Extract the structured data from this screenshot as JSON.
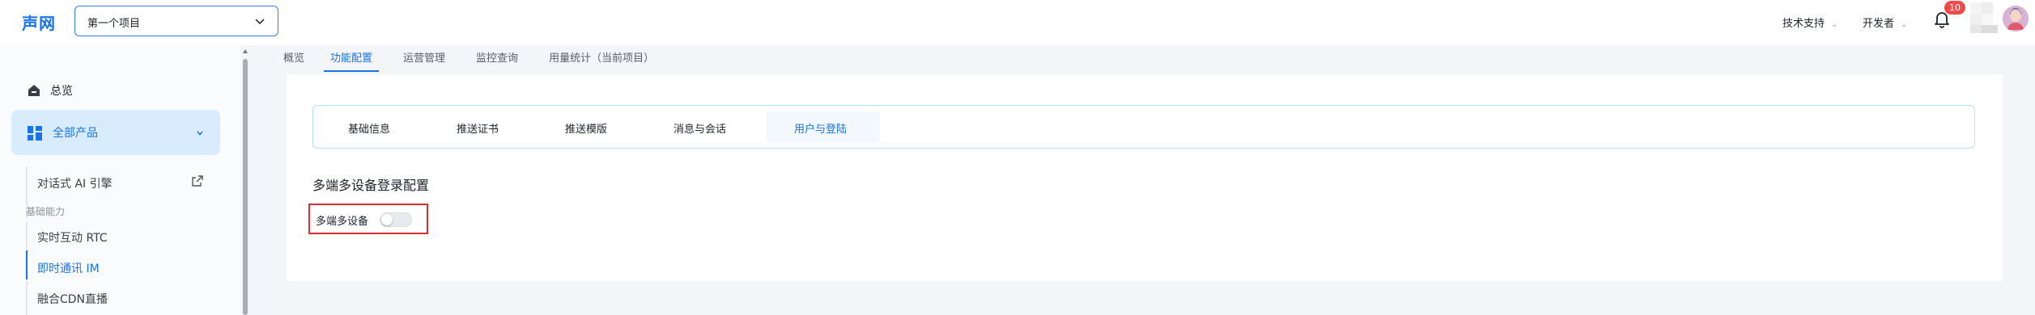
{
  "header": {
    "logo": "声网",
    "project_select": "第一个项目",
    "support": "技术支持",
    "developer": "开发者",
    "notification_count": "10"
  },
  "sidebar": {
    "home": "总览",
    "all_products": "全部产品",
    "items": [
      {
        "label": "对话式 AI 引擎",
        "external": true
      },
      {
        "group": "基础能力"
      },
      {
        "label": "实时互动 RTC"
      },
      {
        "label": "即时通讯 IM",
        "active": true
      },
      {
        "label": "融合CDN直播"
      }
    ]
  },
  "tabs": [
    "概览",
    "功能配置",
    "运营管理",
    "监控查询",
    "用量统计（当前项目）"
  ],
  "active_tab": "功能配置",
  "subtabs": [
    "基础信息",
    "推送证书",
    "推送模版",
    "消息与会话",
    "用户与登陆"
  ],
  "active_subtab": "用户与登陆",
  "section": {
    "title": "多端多设备登录配置",
    "setting_label": "多端多设备",
    "toggle_on": false
  },
  "colors": {
    "accent": "#1a73e8",
    "highlight_border": "#e02e2e",
    "badge": "#f04b4b"
  }
}
